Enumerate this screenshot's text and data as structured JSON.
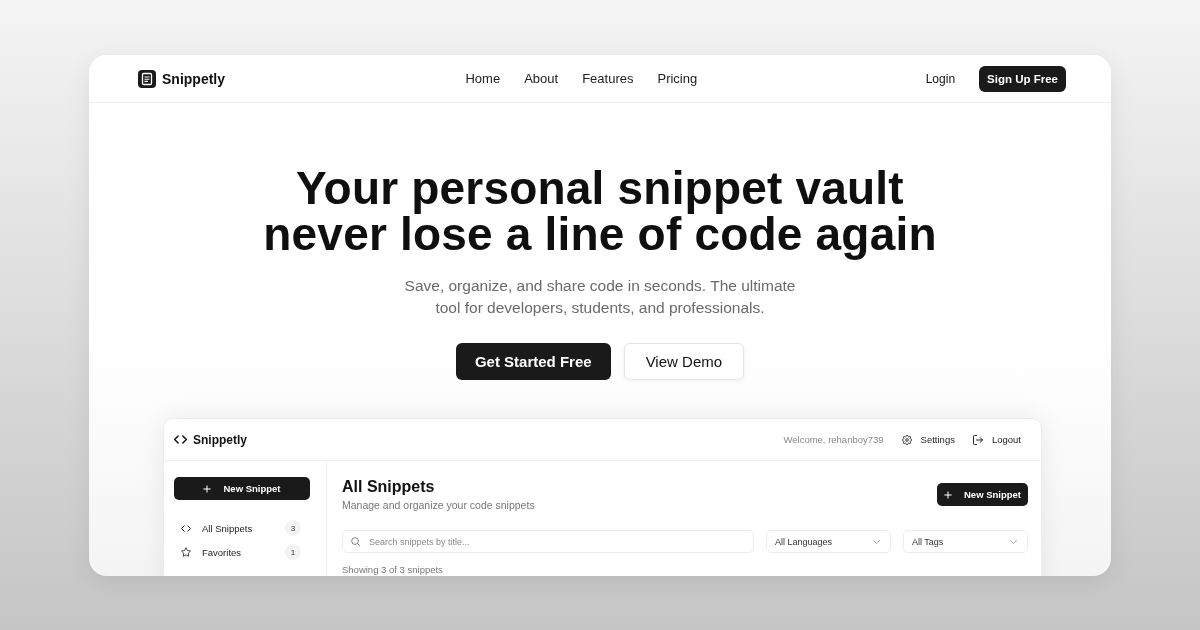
{
  "nav": {
    "brand": "Snippetly",
    "links": [
      "Home",
      "About",
      "Features",
      "Pricing"
    ],
    "login": "Login",
    "signup": "Sign Up Free"
  },
  "hero": {
    "headline": [
      "Your personal snippet vault",
      "never lose a line of code again"
    ],
    "subtitle": "Save, organize, and share code in seconds. The ultimate tool for developers, students, and professionals.",
    "buttons": [
      {
        "label": "Get Started Free",
        "kind": "primary"
      },
      {
        "label": "View Demo",
        "kind": "secondary"
      }
    ]
  },
  "app_preview": {
    "brand": "Snippetly",
    "welcome": "Welcome, rehanboy739",
    "header_links": [
      {
        "label": "Settings",
        "kind": "settings"
      },
      {
        "label": "Logout",
        "kind": "logout"
      }
    ],
    "sidebar": {
      "new_button": "New Snippet",
      "items": [
        {
          "label": "All Snippets",
          "count": "3",
          "kind": "code"
        },
        {
          "label": "Favorites",
          "count": "1",
          "kind": "star"
        }
      ]
    },
    "main": {
      "title": "All Snippets",
      "subtitle": "Manage and organize your code snippets",
      "new_button": "New Snippet",
      "search": {
        "placeholder": "Search snippets by title..."
      },
      "filters": [
        "All Languages",
        "All Tags"
      ],
      "result_count": "Showing 3 of 3 snippets"
    }
  }
}
